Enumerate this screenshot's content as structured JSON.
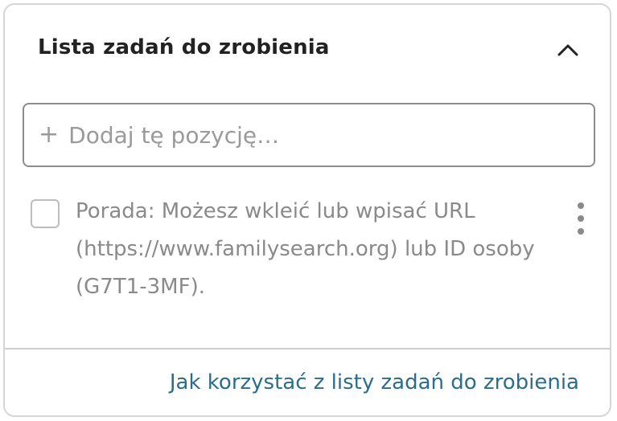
{
  "panel": {
    "title": "Lista zadań do zrobienia",
    "collapse_icon": "chevron-up-icon"
  },
  "add_item": {
    "plus": "+",
    "placeholder": "Dodaj tę pozycję…"
  },
  "tasks": [
    {
      "checked": false,
      "text": "Porada: Możesz wkleić lub wpisać URL (https://www.familysearch.org) lub ID osoby (G7T1-3MF).",
      "menu_icon": "more-vertical-icon"
    }
  ],
  "footer": {
    "help_link": "Jak korzystać z listy zadań do zrobienia"
  },
  "colors": {
    "title": "#222222",
    "muted_text": "#8a8a8a",
    "link": "#2b6e8c",
    "border": "#d6d6d6"
  }
}
